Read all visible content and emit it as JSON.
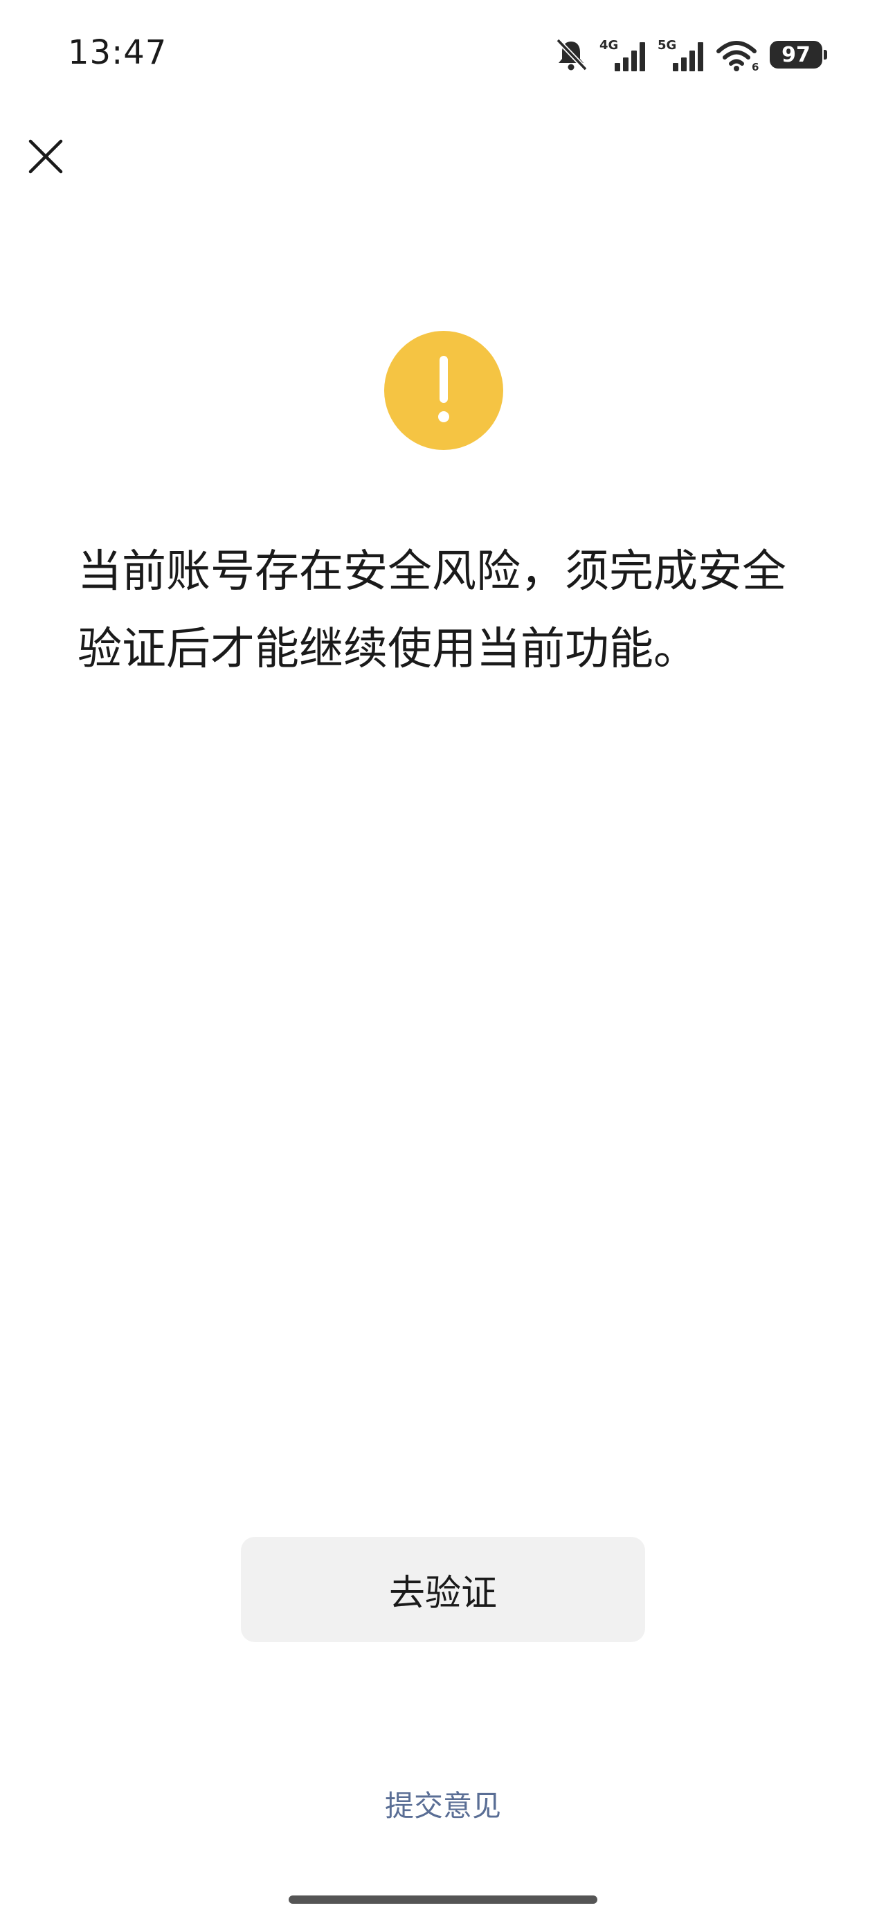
{
  "status_bar": {
    "time": "13:47",
    "network_1": "4G",
    "network_2": "5G",
    "wifi_label": "6",
    "battery": "97",
    "icons": [
      "mute-icon",
      "signal-4g-icon",
      "signal-5g-icon",
      "wifi-icon",
      "battery-icon"
    ]
  },
  "header": {
    "close_icon": "close-icon"
  },
  "warning": {
    "icon": "exclamation-icon",
    "color": "#f5c443",
    "symbol": "!"
  },
  "message": {
    "text": "当前账号存在安全风险，须完成安全验证后才能继续使用当前功能。"
  },
  "actions": {
    "verify_label": "去验证",
    "feedback_label": "提交意见"
  },
  "colors": {
    "feedback_link": "#5a6e95",
    "button_bg": "#f1f1f1"
  }
}
